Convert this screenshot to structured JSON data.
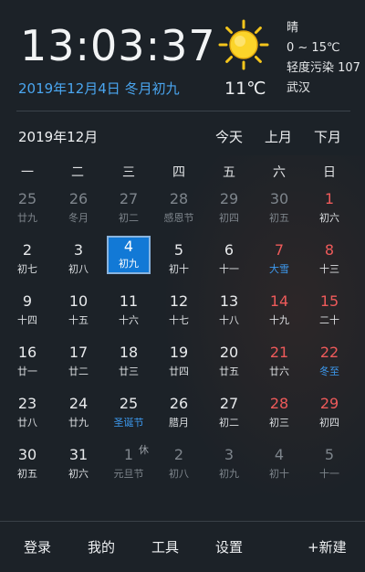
{
  "clock": {
    "time": "13:03:37"
  },
  "date_line": "2019年12月4日 冬月初九",
  "weather": {
    "condition": "晴",
    "range": "0 ~ 15℃",
    "air": "轻度污染 107",
    "city": "武汉",
    "current_temp": "11℃",
    "icon": "sun-icon"
  },
  "calendar": {
    "month_label": "2019年12月",
    "nav": {
      "today": "今天",
      "prev": "上月",
      "next": "下月"
    },
    "weekdays": [
      "一",
      "二",
      "三",
      "四",
      "五",
      "六",
      "日"
    ],
    "colors": {
      "normal_num": "#e8eaec",
      "dim_num": "#7e858c",
      "weekend_num": "#ee5a5a",
      "dim_weekend_num": "#7e858c",
      "lunar": "#dcdfe2",
      "dim_lunar": "#7e858c",
      "festival": "#3d9af0"
    },
    "weeks": [
      [
        {
          "num": "25",
          "lunar": "廿九",
          "dim": true
        },
        {
          "num": "26",
          "lunar": "冬月",
          "dim": true
        },
        {
          "num": "27",
          "lunar": "初二",
          "dim": true
        },
        {
          "num": "28",
          "lunar": "感恩节",
          "dim": true
        },
        {
          "num": "29",
          "lunar": "初四",
          "dim": true
        },
        {
          "num": "30",
          "lunar": "初五",
          "dim": true
        },
        {
          "num": "1",
          "lunar": "初六",
          "weekend": true
        }
      ],
      [
        {
          "num": "2",
          "lunar": "初七"
        },
        {
          "num": "3",
          "lunar": "初八"
        },
        {
          "num": "4",
          "lunar": "初九",
          "selected": true
        },
        {
          "num": "5",
          "lunar": "初十"
        },
        {
          "num": "6",
          "lunar": "十一"
        },
        {
          "num": "7",
          "lunar": "大雪",
          "weekend": true,
          "festival": true
        },
        {
          "num": "8",
          "lunar": "十三",
          "weekend": true
        }
      ],
      [
        {
          "num": "9",
          "lunar": "十四"
        },
        {
          "num": "10",
          "lunar": "十五"
        },
        {
          "num": "11",
          "lunar": "十六"
        },
        {
          "num": "12",
          "lunar": "十七"
        },
        {
          "num": "13",
          "lunar": "十八"
        },
        {
          "num": "14",
          "lunar": "十九",
          "weekend": true
        },
        {
          "num": "15",
          "lunar": "二十",
          "weekend": true
        }
      ],
      [
        {
          "num": "16",
          "lunar": "廿一"
        },
        {
          "num": "17",
          "lunar": "廿二"
        },
        {
          "num": "18",
          "lunar": "廿三"
        },
        {
          "num": "19",
          "lunar": "廿四"
        },
        {
          "num": "20",
          "lunar": "廿五"
        },
        {
          "num": "21",
          "lunar": "廿六",
          "weekend": true
        },
        {
          "num": "22",
          "lunar": "冬至",
          "weekend": true,
          "festival": true
        }
      ],
      [
        {
          "num": "23",
          "lunar": "廿八"
        },
        {
          "num": "24",
          "lunar": "廿九"
        },
        {
          "num": "25",
          "lunar": "圣诞节",
          "festival": true
        },
        {
          "num": "26",
          "lunar": "腊月"
        },
        {
          "num": "27",
          "lunar": "初二"
        },
        {
          "num": "28",
          "lunar": "初三",
          "weekend": true
        },
        {
          "num": "29",
          "lunar": "初四",
          "weekend": true
        }
      ],
      [
        {
          "num": "30",
          "lunar": "初五"
        },
        {
          "num": "31",
          "lunar": "初六"
        },
        {
          "num": "1",
          "lunar": "元旦节",
          "dim": true,
          "rest": "休"
        },
        {
          "num": "2",
          "lunar": "初八",
          "dim": true
        },
        {
          "num": "3",
          "lunar": "初九",
          "dim": true
        },
        {
          "num": "4",
          "lunar": "初十",
          "dim": true
        },
        {
          "num": "5",
          "lunar": "十一",
          "dim": true
        }
      ]
    ]
  },
  "footer": {
    "login": "登录",
    "mine": "我的",
    "tools": "工具",
    "settings": "设置",
    "new": "+新建"
  }
}
